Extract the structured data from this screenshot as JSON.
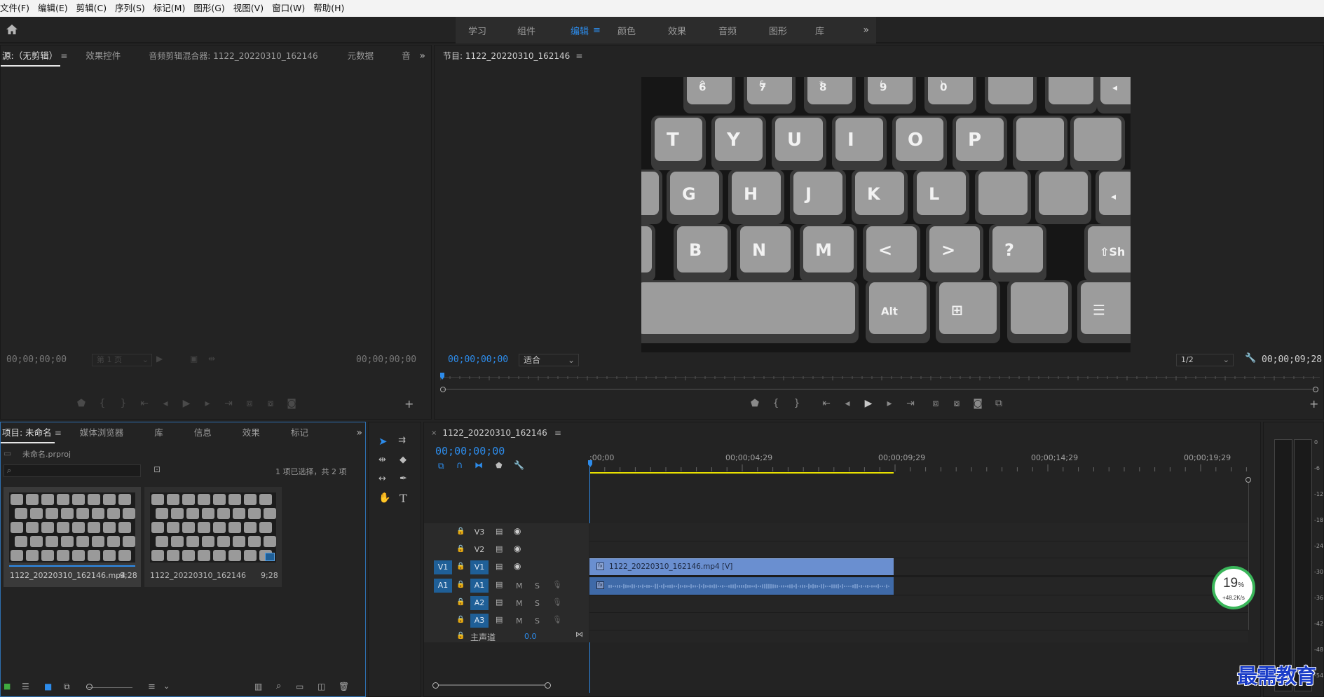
{
  "menu": [
    "文件(F)",
    "编辑(E)",
    "剪辑(C)",
    "序列(S)",
    "标记(M)",
    "图形(G)",
    "视图(V)",
    "窗口(W)",
    "帮助(H)"
  ],
  "workspaces": [
    {
      "label": "学习"
    },
    {
      "label": "组件"
    },
    {
      "label": "编辑",
      "active": true
    },
    {
      "label": "颜色"
    },
    {
      "label": "效果"
    },
    {
      "label": "音频"
    },
    {
      "label": "图形"
    },
    {
      "label": "库"
    }
  ],
  "source_panel": {
    "tabs": [
      "源:（无剪辑）",
      "效果控件",
      "音频剪辑混合器: 1122_20220310_162146",
      "元数据",
      "音"
    ],
    "timecode_left": "00;00;00;00",
    "page": "第 1 页",
    "timecode_right": "00;00;00;00"
  },
  "program_panel": {
    "title": "节目: 1122_20220310_162146",
    "timecode": "00;00;00;00",
    "fit": "适合",
    "resolution": "1/2",
    "duration": "00;00;09;28",
    "keys": {
      "row1": [
        "6",
        "7",
        "8",
        "9",
        "0"
      ],
      "row1_top": [
        "^",
        "&",
        "*",
        "(",
        ")"
      ],
      "row2": [
        "T",
        "Y",
        "U",
        "I",
        "O",
        "P"
      ],
      "row3": [
        "G",
        "H",
        "J",
        "K",
        "L"
      ],
      "row4": [
        "B",
        "N",
        "M",
        "<",
        ">",
        "?"
      ],
      "alt": "Alt",
      "shift": "⇧Sh"
    }
  },
  "project_panel": {
    "tabs": [
      "项目: 未命名",
      "媒体浏览器",
      "库",
      "信息",
      "效果",
      "标记"
    ],
    "project_file": "未命名.prproj",
    "selection_info": "1 项已选择，共 2 项",
    "items": [
      {
        "name": "1122_20220310_162146.mp4",
        "duration": "9;28"
      },
      {
        "name": "1122_20220310_162146",
        "duration": "9;28"
      }
    ]
  },
  "timeline": {
    "sequence_tab": "1122_20220310_162146",
    "timecode": "00;00;00;00",
    "ruler": [
      ";00;00",
      "00;00;04;29",
      "00;00;09;29",
      "00;00;14;29",
      "00;00;19;29"
    ],
    "tracks": {
      "video": [
        "V3",
        "V2",
        "V1"
      ],
      "audio": [
        "A1",
        "A2",
        "A3"
      ],
      "master": "主声道",
      "master_value": "0.0",
      "mute": "M",
      "solo": "S"
    },
    "clip_label": "1122_20220310_162146.mp4 [V]"
  },
  "meter_labels": [
    "0",
    "-6",
    "-12",
    "-18",
    "-24",
    "-30",
    "-36",
    "-42",
    "-48",
    "-54"
  ],
  "network_widget": {
    "percent": "19",
    "unit": "%",
    "speed": "+48.2K/s"
  },
  "watermark": "最需教育",
  "colors": {
    "accent": "#2d8ceb",
    "clip_video": "#6a8fd0",
    "clip_audio": "#3f6aa8",
    "selected_track": "#1f5f97"
  }
}
